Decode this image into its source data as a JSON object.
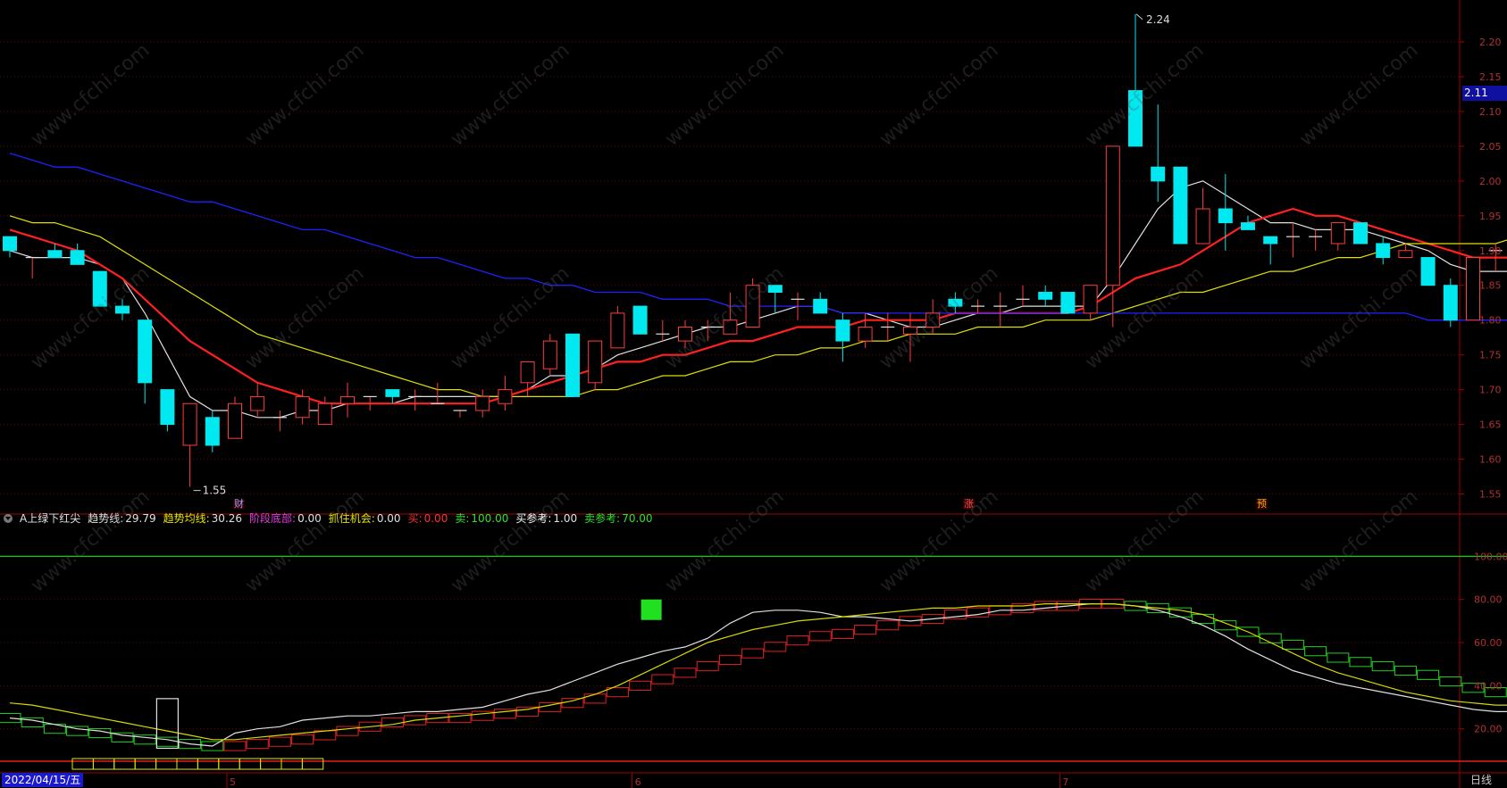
{
  "header": {
    "indicator_name": "A上绿下红尖",
    "fields": [
      {
        "label": "趋势线:",
        "value": "29.79",
        "color": "#e0e0e0"
      },
      {
        "label": "趋势均线:",
        "value": "30.26",
        "color": "#e6e600"
      },
      {
        "label": "阶段底部:",
        "value": "0.00",
        "color": "#e040e0"
      },
      {
        "label": "抓住机会:",
        "value": "0.00",
        "color": "#e6e600"
      },
      {
        "label": "买:",
        "value": "0.00",
        "color": "#ff3030"
      },
      {
        "label": "卖:",
        "value": "100.00",
        "color": "#30e030"
      },
      {
        "label": "买参考:",
        "value": "1.00",
        "color": "#ffffff"
      },
      {
        "label": "卖参考:",
        "value": "70.00",
        "color": "#30e030"
      }
    ]
  },
  "last_price": "2.11",
  "start_date": "2022/04/15/五",
  "period": "日线",
  "watermark": "www.cfchi.com",
  "event_markers": [
    {
      "text": "财",
      "color": "#a0a0ff"
    },
    {
      "text": "涨",
      "color": "#ff5050"
    },
    {
      "text": "预",
      "color": "#ffb000"
    }
  ],
  "colors": {
    "up": "#ff3b3b",
    "down": "#00e8f0",
    "ma5": "#e0e0e0",
    "ma10": "#ff2020",
    "ma20": "#e0e000",
    "ma60": "#2020ff",
    "axis": "#a00000",
    "label": "#b03030"
  },
  "chart_data": [
    {
      "type": "candlestick",
      "title": "",
      "ylim": [
        1.525,
        2.25
      ],
      "yticks": [
        1.55,
        1.6,
        1.65,
        1.7,
        1.75,
        1.8,
        1.85,
        1.9,
        1.95,
        2.0,
        2.05,
        2.1,
        2.15,
        2.2
      ],
      "max_label": "2.24",
      "min_label": "1.55",
      "candles": [
        [
          1.92,
          1.92,
          1.89,
          1.9
        ],
        [
          1.89,
          1.89,
          1.86,
          1.89
        ],
        [
          1.9,
          1.91,
          1.89,
          1.89
        ],
        [
          1.9,
          1.91,
          1.88,
          1.88
        ],
        [
          1.87,
          1.87,
          1.82,
          1.82
        ],
        [
          1.82,
          1.83,
          1.8,
          1.81
        ],
        [
          1.8,
          1.8,
          1.68,
          1.71
        ],
        [
          1.7,
          1.7,
          1.64,
          1.65
        ],
        [
          1.62,
          1.68,
          1.56,
          1.68
        ],
        [
          1.66,
          1.67,
          1.61,
          1.62
        ],
        [
          1.63,
          1.69,
          1.63,
          1.68
        ],
        [
          1.67,
          1.71,
          1.66,
          1.69
        ],
        [
          1.66,
          1.67,
          1.64,
          1.66
        ],
        [
          1.66,
          1.7,
          1.65,
          1.69
        ],
        [
          1.65,
          1.69,
          1.65,
          1.68
        ],
        [
          1.68,
          1.71,
          1.66,
          1.69
        ],
        [
          1.69,
          1.69,
          1.67,
          1.69
        ],
        [
          1.7,
          1.7,
          1.68,
          1.69
        ],
        [
          1.69,
          1.7,
          1.67,
          1.69
        ],
        [
          1.68,
          1.71,
          1.68,
          1.68
        ],
        [
          1.67,
          1.67,
          1.66,
          1.67
        ],
        [
          1.67,
          1.7,
          1.66,
          1.69
        ],
        [
          1.68,
          1.72,
          1.67,
          1.7
        ],
        [
          1.71,
          1.74,
          1.69,
          1.74
        ],
        [
          1.73,
          1.78,
          1.72,
          1.77
        ],
        [
          1.78,
          1.78,
          1.69,
          1.69
        ],
        [
          1.71,
          1.77,
          1.7,
          1.77
        ],
        [
          1.76,
          1.82,
          1.76,
          1.81
        ],
        [
          1.82,
          1.82,
          1.78,
          1.78
        ],
        [
          1.78,
          1.8,
          1.77,
          1.78
        ],
        [
          1.77,
          1.8,
          1.76,
          1.79
        ],
        [
          1.79,
          1.8,
          1.77,
          1.79
        ],
        [
          1.78,
          1.84,
          1.78,
          1.8
        ],
        [
          1.79,
          1.86,
          1.79,
          1.85
        ],
        [
          1.85,
          1.85,
          1.81,
          1.84
        ],
        [
          1.83,
          1.84,
          1.8,
          1.83
        ],
        [
          1.83,
          1.84,
          1.81,
          1.81
        ],
        [
          1.8,
          1.81,
          1.74,
          1.77
        ],
        [
          1.77,
          1.81,
          1.76,
          1.79
        ],
        [
          1.79,
          1.81,
          1.77,
          1.79
        ],
        [
          1.78,
          1.81,
          1.74,
          1.79
        ],
        [
          1.79,
          1.83,
          1.78,
          1.81
        ],
        [
          1.83,
          1.84,
          1.81,
          1.82
        ],
        [
          1.82,
          1.83,
          1.81,
          1.82
        ],
        [
          1.82,
          1.84,
          1.79,
          1.82
        ],
        [
          1.83,
          1.85,
          1.82,
          1.83
        ],
        [
          1.84,
          1.85,
          1.82,
          1.83
        ],
        [
          1.84,
          1.84,
          1.81,
          1.81
        ],
        [
          1.81,
          1.85,
          1.8,
          1.85
        ],
        [
          1.85,
          2.05,
          1.79,
          2.05
        ],
        [
          2.13,
          2.24,
          2.05,
          2.05
        ],
        [
          2.02,
          2.11,
          1.97,
          2.0
        ],
        [
          2.02,
          2.02,
          1.91,
          1.91
        ],
        [
          1.91,
          1.99,
          1.91,
          1.96
        ],
        [
          1.96,
          2.01,
          1.9,
          1.94
        ],
        [
          1.94,
          1.95,
          1.93,
          1.93
        ],
        [
          1.92,
          1.92,
          1.88,
          1.91
        ],
        [
          1.92,
          1.94,
          1.89,
          1.92
        ],
        [
          1.92,
          1.93,
          1.9,
          1.92
        ],
        [
          1.91,
          1.94,
          1.9,
          1.94
        ],
        [
          1.94,
          1.94,
          1.91,
          1.91
        ],
        [
          1.91,
          1.92,
          1.88,
          1.89
        ],
        [
          1.89,
          1.91,
          1.89,
          1.9
        ],
        [
          1.89,
          1.89,
          1.85,
          1.85
        ],
        [
          1.85,
          1.86,
          1.79,
          1.8
        ],
        [
          1.8,
          1.89,
          1.8,
          1.89
        ],
        [
          1.9,
          1.91,
          1.87,
          1.9
        ],
        [
          1.9,
          1.92,
          1.89,
          1.9
        ],
        [
          1.91,
          2.0,
          1.91,
          1.96
        ],
        [
          1.95,
          1.98,
          1.93,
          1.94
        ]
      ],
      "series": [
        {
          "values": [
            1.9,
            1.89,
            1.89,
            1.89,
            1.88,
            1.86,
            1.81,
            1.75,
            1.69,
            1.67,
            1.67,
            1.66,
            1.66,
            1.67,
            1.67,
            1.68,
            1.68,
            1.68,
            1.69,
            1.69,
            1.69,
            1.69,
            1.69,
            1.7,
            1.72,
            1.72,
            1.73,
            1.75,
            1.76,
            1.77,
            1.78,
            1.79,
            1.79,
            1.8,
            1.81,
            1.82,
            1.82,
            1.81,
            1.81,
            1.8,
            1.79,
            1.79,
            1.8,
            1.81,
            1.81,
            1.82,
            1.82,
            1.82,
            1.82,
            1.86,
            1.91,
            1.96,
            1.99,
            2.0,
            1.98,
            1.96,
            1.94,
            1.94,
            1.93,
            1.93,
            1.93,
            1.92,
            1.91,
            1.9,
            1.88,
            1.87,
            1.87,
            1.87,
            1.88,
            1.91
          ]
        },
        {
          "values": [
            1.93,
            1.92,
            1.91,
            1.9,
            1.88,
            1.86,
            1.83,
            1.8,
            1.77,
            1.75,
            1.73,
            1.71,
            1.7,
            1.69,
            1.68,
            1.68,
            1.68,
            1.68,
            1.68,
            1.68,
            1.68,
            1.68,
            1.69,
            1.7,
            1.71,
            1.72,
            1.73,
            1.74,
            1.74,
            1.75,
            1.75,
            1.76,
            1.77,
            1.77,
            1.78,
            1.79,
            1.79,
            1.79,
            1.8,
            1.8,
            1.8,
            1.8,
            1.81,
            1.81,
            1.81,
            1.81,
            1.81,
            1.81,
            1.82,
            1.84,
            1.86,
            1.87,
            1.88,
            1.9,
            1.92,
            1.94,
            1.95,
            1.96,
            1.95,
            1.95,
            1.94,
            1.93,
            1.92,
            1.91,
            1.9,
            1.89,
            1.89,
            1.89,
            1.89,
            1.89
          ]
        },
        {
          "values": [
            1.95,
            1.94,
            1.94,
            1.93,
            1.92,
            1.9,
            1.88,
            1.86,
            1.84,
            1.82,
            1.8,
            1.78,
            1.77,
            1.76,
            1.75,
            1.74,
            1.73,
            1.72,
            1.71,
            1.7,
            1.7,
            1.69,
            1.69,
            1.69,
            1.69,
            1.69,
            1.7,
            1.7,
            1.71,
            1.72,
            1.72,
            1.73,
            1.74,
            1.74,
            1.75,
            1.75,
            1.76,
            1.76,
            1.77,
            1.77,
            1.78,
            1.78,
            1.78,
            1.79,
            1.79,
            1.79,
            1.8,
            1.8,
            1.8,
            1.81,
            1.82,
            1.83,
            1.84,
            1.84,
            1.85,
            1.86,
            1.87,
            1.87,
            1.88,
            1.89,
            1.89,
            1.9,
            1.91,
            1.91,
            1.91,
            1.91,
            1.91,
            1.92,
            1.92,
            1.93
          ]
        },
        {
          "values": [
            2.04,
            2.03,
            2.02,
            2.02,
            2.01,
            2.0,
            1.99,
            1.98,
            1.97,
            1.97,
            1.96,
            1.95,
            1.94,
            1.93,
            1.93,
            1.92,
            1.91,
            1.9,
            1.89,
            1.89,
            1.88,
            1.87,
            1.86,
            1.86,
            1.85,
            1.85,
            1.84,
            1.84,
            1.84,
            1.83,
            1.83,
            1.83,
            1.82,
            1.82,
            1.82,
            1.82,
            1.82,
            1.81,
            1.81,
            1.81,
            1.81,
            1.81,
            1.81,
            1.81,
            1.81,
            1.81,
            1.81,
            1.81,
            1.81,
            1.81,
            1.81,
            1.81,
            1.81,
            1.81,
            1.81,
            1.81,
            1.81,
            1.81,
            1.81,
            1.81,
            1.81,
            1.81,
            1.81,
            1.8,
            1.8,
            1.8,
            1.8,
            1.8,
            1.81,
            1.81
          ]
        }
      ],
      "xticks": [
        "5",
        "6",
        "7"
      ]
    },
    {
      "type": "line",
      "title": "",
      "ylim": [
        0,
        113
      ],
      "yticks": [
        20.0,
        40.0,
        60.0,
        80.0,
        100.0
      ],
      "steps": [
        25,
        23,
        20,
        19,
        18,
        16,
        15,
        14,
        13,
        12,
        12,
        13,
        14,
        15,
        17,
        19,
        21,
        23,
        24,
        25,
        25,
        26,
        27,
        28,
        30,
        32,
        34,
        37,
        40,
        43,
        46,
        49,
        52,
        55,
        58,
        61,
        63,
        64,
        66,
        68,
        70,
        71,
        73,
        74,
        75,
        76,
        77,
        77,
        78,
        78,
        77,
        76,
        74,
        71,
        68,
        65,
        62,
        59,
        56,
        53,
        51,
        49,
        47,
        45,
        42,
        39,
        37,
        36,
        35,
        35
      ],
      "series": [
        {
          "values": [
            25,
            24,
            22,
            20,
            19,
            17,
            16,
            15,
            13,
            12,
            18,
            20,
            21,
            24,
            25,
            26,
            26,
            27,
            28,
            28,
            29,
            30,
            33,
            36,
            38,
            42,
            46,
            50,
            53,
            56,
            58,
            62,
            69,
            74,
            75,
            75,
            74,
            72,
            72,
            71,
            70,
            71,
            72,
            73,
            75,
            75,
            76,
            77,
            78,
            78,
            77,
            75,
            72,
            68,
            63,
            57,
            52,
            47,
            44,
            41,
            39,
            37,
            35,
            33,
            31,
            29,
            28,
            28,
            29,
            30
          ]
        },
        {
          "values": [
            32,
            31,
            29,
            27,
            25,
            23,
            21,
            19,
            17,
            15,
            15,
            16,
            17,
            18,
            19,
            20,
            21,
            22,
            24,
            25,
            26,
            27,
            28,
            29,
            31,
            33,
            36,
            40,
            45,
            50,
            55,
            60,
            63,
            66,
            68,
            70,
            71,
            72,
            73,
            74,
            75,
            76,
            76,
            77,
            77,
            77,
            78,
            78,
            78,
            78,
            77,
            76,
            75,
            73,
            69,
            65,
            60,
            55,
            50,
            46,
            43,
            40,
            37,
            35,
            33,
            32,
            31,
            31,
            30,
            30
          ]
        },
        {
          "values": [
            100,
            100,
            100,
            100,
            100,
            100,
            100,
            100,
            100,
            100,
            100,
            100,
            100,
            100,
            100,
            100,
            100,
            100,
            100,
            100,
            100,
            100,
            100,
            100,
            100,
            100,
            100,
            100,
            100,
            100,
            100,
            100,
            100,
            100,
            100,
            100,
            100,
            100,
            100,
            100,
            100,
            100,
            100,
            100,
            100,
            100,
            100,
            100,
            100,
            100,
            100,
            100,
            100,
            100,
            100,
            100,
            100,
            100,
            100,
            100,
            100,
            100,
            100,
            100,
            100,
            100,
            100,
            100,
            100,
            100
          ]
        }
      ]
    }
  ]
}
